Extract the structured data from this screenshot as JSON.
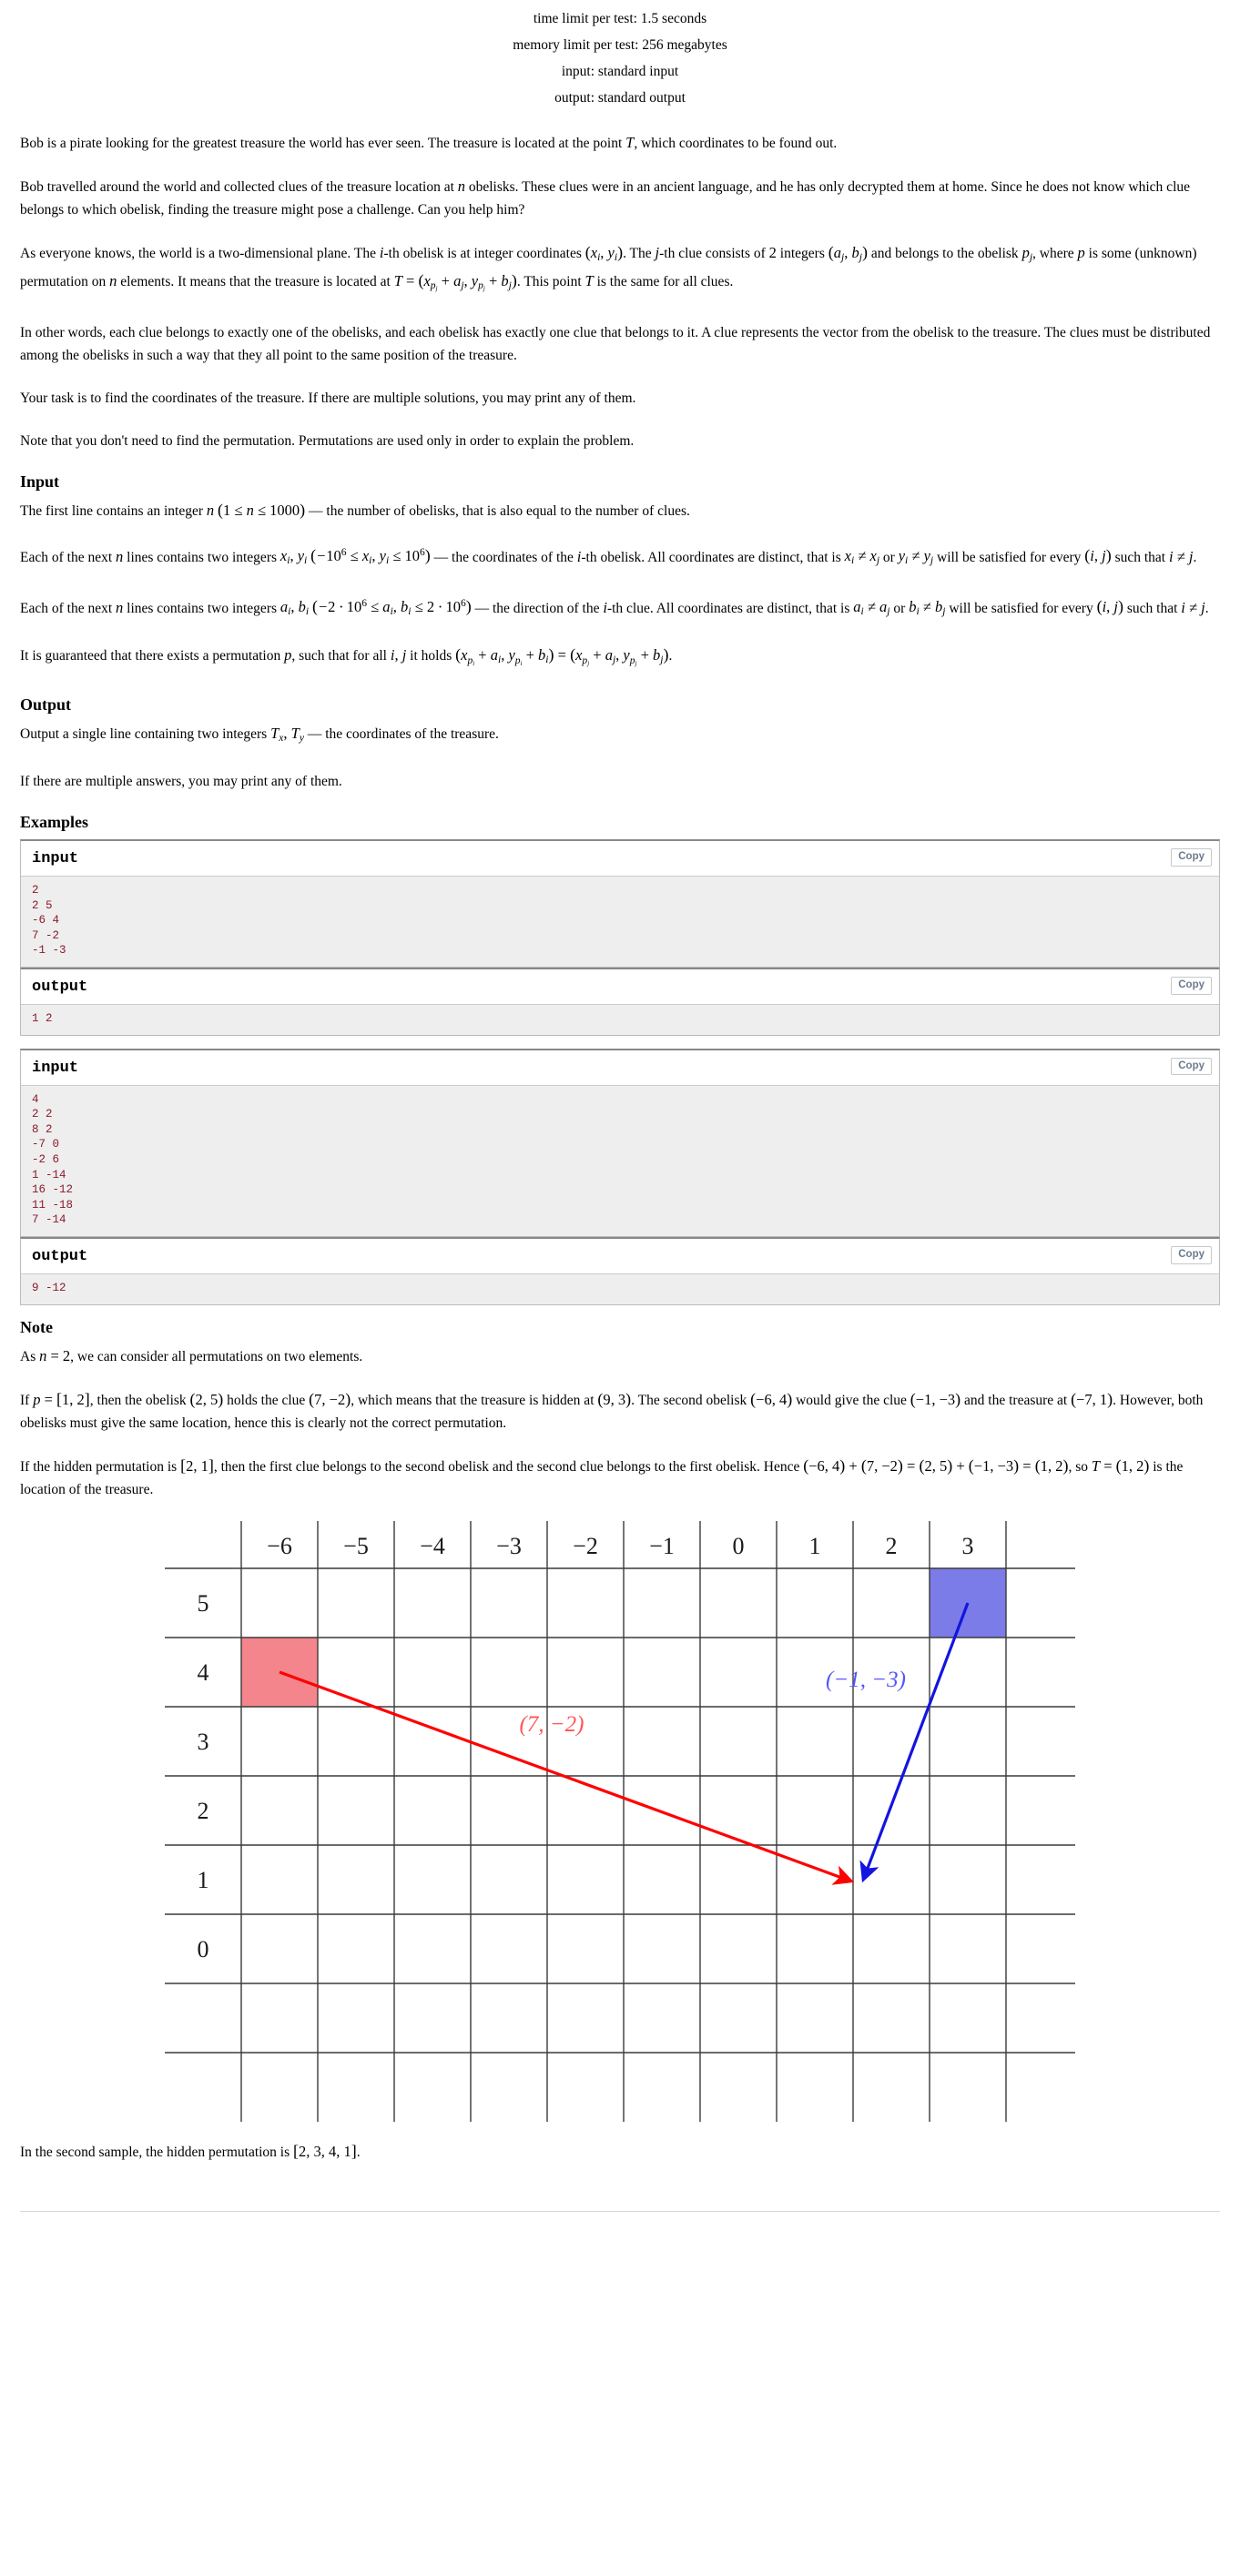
{
  "limits": {
    "time": "time limit per test: 1.5 seconds",
    "memory": "memory limit per test: 256 megabytes",
    "input": "input: standard input",
    "output": "output: standard output"
  },
  "statement": {
    "p1_a": "Bob is a pirate looking for the greatest treasure the world has ever seen. The treasure is located at the point ",
    "p1_t": "T",
    "p1_b": ", which coordinates to be found out.",
    "p2_a": "Bob travelled around the world and collected clues of the treasure location at ",
    "p2_n": "n",
    "p2_b": " obelisks. These clues were in an ancient language, and he has only decrypted them at home. Since he does not know which clue belongs to which obelisk, finding the treasure might pose a challenge. Can you help him?",
    "p3_a": "As everyone knows, the world is a two-dimensional plane. The ",
    "p3_i": "i",
    "p3_b": "-th obelisk is at integer coordinates ",
    "p3_xy": "(x_i, y_i)",
    "p3_c": ". The ",
    "p3_j": "j",
    "p3_d": "-th clue consists of ",
    "p3_two": "2",
    "p3_e": " integers ",
    "p3_ab": "(a_j, b_j)",
    "p3_f": " and belongs to the obelisk ",
    "p3_pj": "p_j",
    "p3_g": ", where ",
    "p3_p": "p",
    "p3_h": " is some (unknown) permutation on ",
    "p3_n2": "n",
    "p3_k": " elements. It means that the treasure is located at ",
    "p3_eq": "T = (x_{p_j} + a_j, y_{p_j} + b_j)",
    "p3_l": ". This point ",
    "p3_t2": "T",
    "p3_m": " is the same for all clues.",
    "p4": "In other words, each clue belongs to exactly one of the obelisks, and each obelisk has exactly one clue that belongs to it. A clue represents the vector from the obelisk to the treasure. The clues must be distributed among the obelisks in such a way that they all point to the same position of the treasure.",
    "p5": "Your task is to find the coordinates of the treasure. If there are multiple solutions, you may print any of them.",
    "p6": "Note that you don't need to find the permutation. Permutations are used only in order to explain the problem."
  },
  "input_section": {
    "title": "Input",
    "l1_a": "The first line contains an integer ",
    "l1_n": "n",
    "l1_range": "(1 ≤ n ≤ 1000)",
    "l1_b": " — the number of obelisks, that is also equal to the number of clues.",
    "l2_a": "Each of the next ",
    "l2_n": "n",
    "l2_b": " lines contains two integers ",
    "l2_xy": "x_i, y_i",
    "l2_range": "(−10^6 ≤ x_i, y_i ≤ 10^6)",
    "l2_c": " — the coordinates of the ",
    "l2_i": "i",
    "l2_d": "-th obelisk. All coordinates are distinct, that is ",
    "l2_ne1": "x_i ≠ x_j",
    "l2_e": " or ",
    "l2_ne2": "y_i ≠ y_j",
    "l2_f": " will be satisfied for every ",
    "l2_ij": "(i, j)",
    "l2_g": " such that ",
    "l2_inej": "i ≠ j",
    "l2_h": ".",
    "l3_a": "Each of the next ",
    "l3_n": "n",
    "l3_b": " lines contains two integers ",
    "l3_ab": "a_i, b_i",
    "l3_range": "(−2 · 10^6 ≤ a_i, b_i ≤ 2 · 10^6)",
    "l3_c": " — the direction of the ",
    "l3_i": "i",
    "l3_d": "-th clue. All coordinates are distinct, that is ",
    "l3_ne1": "a_i ≠ a_j",
    "l3_e": " or ",
    "l3_ne2": "b_i ≠ b_j",
    "l3_f": " will be satisfied for every ",
    "l3_ij": "(i, j)",
    "l3_g": " such that ",
    "l3_inej": "i ≠ j",
    "l3_h": ".",
    "l4_a": "It is guaranteed that there exists a permutation ",
    "l4_p": "p",
    "l4_b": ", such that for all ",
    "l4_ij": "i, j",
    "l4_c": " it holds ",
    "l4_eq": "(x_{p_i} + a_i, y_{p_i} + b_i) = (x_{p_j} + a_j, y_{p_j} + b_j)",
    "l4_d": "."
  },
  "output_section": {
    "title": "Output",
    "l1_a": "Output a single line containing two integers ",
    "l1_t": "T_x, T_y",
    "l1_b": " — the coordinates of the treasure.",
    "l2": "If there are multiple answers, you may print any of them."
  },
  "examples": {
    "title": "Examples",
    "copy_label": "Copy",
    "items": [
      {
        "input_label": "input",
        "input_text": "2\n2 5\n-6 4\n7 -2\n-1 -3",
        "output_label": "output",
        "output_text": "1 2"
      },
      {
        "input_label": "input",
        "input_text": "4\n2 2\n8 2\n-7 0\n-2 6\n1 -14\n16 -12\n11 -18\n7 -14",
        "output_label": "output",
        "output_text": "9 -12"
      }
    ]
  },
  "note_section": {
    "title": "Note",
    "n1_a": "As ",
    "n1_eq": "n = 2",
    "n1_b": ", we can consider all permutations on two elements.",
    "n2_a": "If ",
    "n2_p": "p = [1, 2]",
    "n2_b": ", then the obelisk ",
    "n2_ob": "(2, 5)",
    "n2_c": " holds the clue ",
    "n2_clue": "(7, −2)",
    "n2_d": ", which means that the treasure is hidden at ",
    "n2_tr": "(9, 3)",
    "n2_e": ". The second obelisk ",
    "n2_ob2": "(−6, 4)",
    "n2_f": " would give the clue ",
    "n2_clue2": "(−1, −3)",
    "n2_g": " and the treasure at ",
    "n2_tr2": "(−7, 1)",
    "n2_h": ". However, both obelisks must give the same location, hence this is clearly not the correct permutation.",
    "n3_a": "If the hidden permutation is ",
    "n3_p": "[2, 1]",
    "n3_b": ", then the first clue belongs to the second obelisk and the second clue belongs to the first obelisk. Hence ",
    "n3_eq": "(−6, 4) + (7, −2) = (2, 5) + (−1, −3) = (1, 2)",
    "n3_c": ", so ",
    "n3_t": "T = (1, 2)",
    "n3_d": " is the location of the treasure.",
    "n4_a": "In the second sample, the hidden permutation is ",
    "n4_perm": "[2, 3, 4, 1]",
    "n4_b": "."
  },
  "figure": {
    "col_labels": [
      "−6",
      "−5",
      "−4",
      "−3",
      "−2",
      "−1",
      "0",
      "1",
      "2",
      "3"
    ],
    "row_labels": [
      "5",
      "4",
      "3",
      "2",
      "1",
      "0"
    ],
    "obelisk_red": {
      "x": "−6",
      "y": "4",
      "color": "#f4858c"
    },
    "obelisk_blue": {
      "x": "2",
      "y": "5",
      "color": "#7b7ce8"
    },
    "clue_red_label": "(7, −2)",
    "clue_blue_label": "(−1, −3)",
    "treasure": {
      "x": "1",
      "y": "2"
    },
    "colors": {
      "red": "#ff0000",
      "blue": "#1414e0",
      "grid": "#3a3a3a"
    }
  }
}
